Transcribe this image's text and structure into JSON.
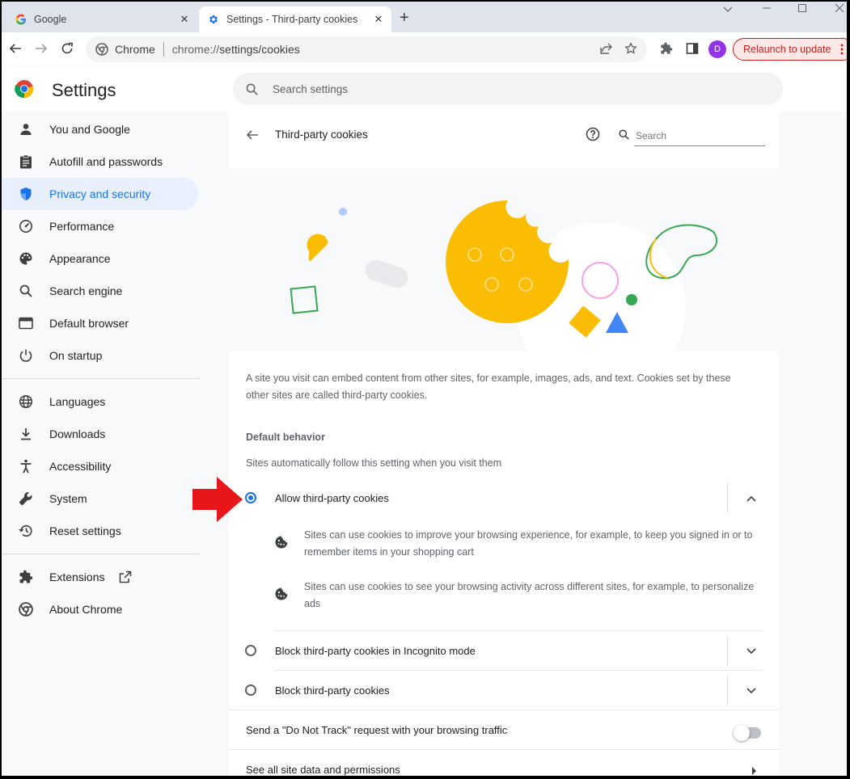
{
  "tabs": [
    {
      "title": "Google",
      "active": false
    },
    {
      "title": "Settings - Third-party cookies",
      "active": true
    }
  ],
  "toolbar": {
    "chip_label": "Chrome",
    "url_scheme": "chrome://",
    "url_rest": "settings/cookies",
    "avatar_letter": "D",
    "relaunch_label": "Relaunch to update"
  },
  "header": {
    "title": "Settings",
    "search_placeholder": "Search settings"
  },
  "sidebar": {
    "items": [
      {
        "label": "You and Google",
        "icon": "person-icon"
      },
      {
        "label": "Autofill and passwords",
        "icon": "clipboard-icon"
      },
      {
        "label": "Privacy and security",
        "icon": "shield-icon",
        "selected": true
      },
      {
        "label": "Performance",
        "icon": "gauge-icon"
      },
      {
        "label": "Appearance",
        "icon": "palette-icon"
      },
      {
        "label": "Search engine",
        "icon": "search-icon"
      },
      {
        "label": "Default browser",
        "icon": "browser-icon"
      },
      {
        "label": "On startup",
        "icon": "power-icon"
      },
      {
        "label": "Languages",
        "icon": "globe-icon"
      },
      {
        "label": "Downloads",
        "icon": "download-icon"
      },
      {
        "label": "Accessibility",
        "icon": "accessibility-icon"
      },
      {
        "label": "System",
        "icon": "wrench-icon"
      },
      {
        "label": "Reset settings",
        "icon": "history-icon"
      },
      {
        "label": "Extensions",
        "icon": "puzzle-icon"
      },
      {
        "label": "About Chrome",
        "icon": "chrome-icon"
      }
    ]
  },
  "page": {
    "title": "Third-party cookies",
    "search_placeholder": "Search",
    "description": "A site you visit can embed content from other sites, for example, images, ads, and text. Cookies set by these other sites are called third-party cookies.",
    "default_behavior_heading": "Default behavior",
    "default_behavior_sub": "Sites automatically follow this setting when you visit them",
    "options": [
      {
        "label": "Allow third-party cookies",
        "selected": true,
        "expanded": true
      },
      {
        "label": "Block third-party cookies in Incognito mode",
        "selected": false
      },
      {
        "label": "Block third-party cookies",
        "selected": false
      }
    ],
    "details": [
      "Sites can use cookies to improve your browsing experience, for example, to keep you signed in or to remember items in your shopping cart",
      "Sites can use cookies to see your browsing activity across different sites, for example, to personalize ads"
    ],
    "do_not_track_label": "Send a \"Do Not Track\" request with your browsing traffic",
    "do_not_track_on": false,
    "see_all_label": "See all site data and permissions"
  },
  "colors": {
    "accent": "#1a73e8",
    "cookie": "#fbbc04",
    "annotation_arrow": "#e8151b"
  }
}
